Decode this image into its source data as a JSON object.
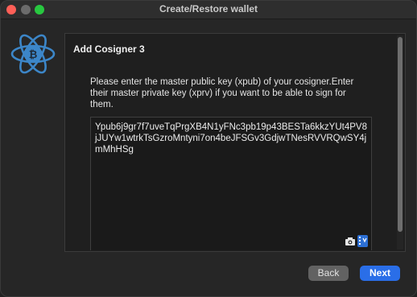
{
  "window": {
    "title": "Create/Restore wallet"
  },
  "panel": {
    "heading": "Add Cosigner 3",
    "instructions": "Please enter the master public key (xpub) of your cosigner.Enter their master private key (xprv) if you want to be able to sign for them.",
    "key_value": "Ypub6j9gr7f7uveTqPrgXB4N1yFNc3pb19p43BESTa6kkzYUt4PV8jJUYw1wtrkTsGzroMntyni7on4beJFSGv3GdjwTNesRVVRQwSY4jmMhHSg"
  },
  "buttons": {
    "back": "Back",
    "next": "Next"
  },
  "icons": {
    "logo": "electrum-bitcoin-logo-icon",
    "camera": "camera-icon",
    "keyboard": "virtual-keyboard-icon"
  },
  "colors": {
    "accent": "#2a6ee8",
    "logo_blue": "#3c86c8",
    "close": "#ff5f57",
    "maximize": "#28c840"
  }
}
